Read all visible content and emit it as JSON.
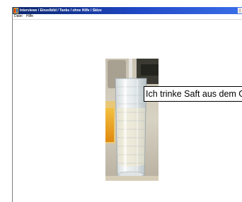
{
  "window": {
    "title": "Interviewe / Einzelbild / Tanks / ohne Hilfe / Sätze"
  },
  "menu": {
    "items": [
      {
        "label": "Datei"
      },
      {
        "label": "Hilfe"
      }
    ]
  },
  "content": {
    "caption": "Ich trinke Saft aus dem Glas"
  },
  "colors": {
    "titlebar_start": "#0a246a",
    "titlebar_end": "#3a6ee8",
    "juice": "#e8a020"
  },
  "icons": {
    "app": "app-icon"
  }
}
